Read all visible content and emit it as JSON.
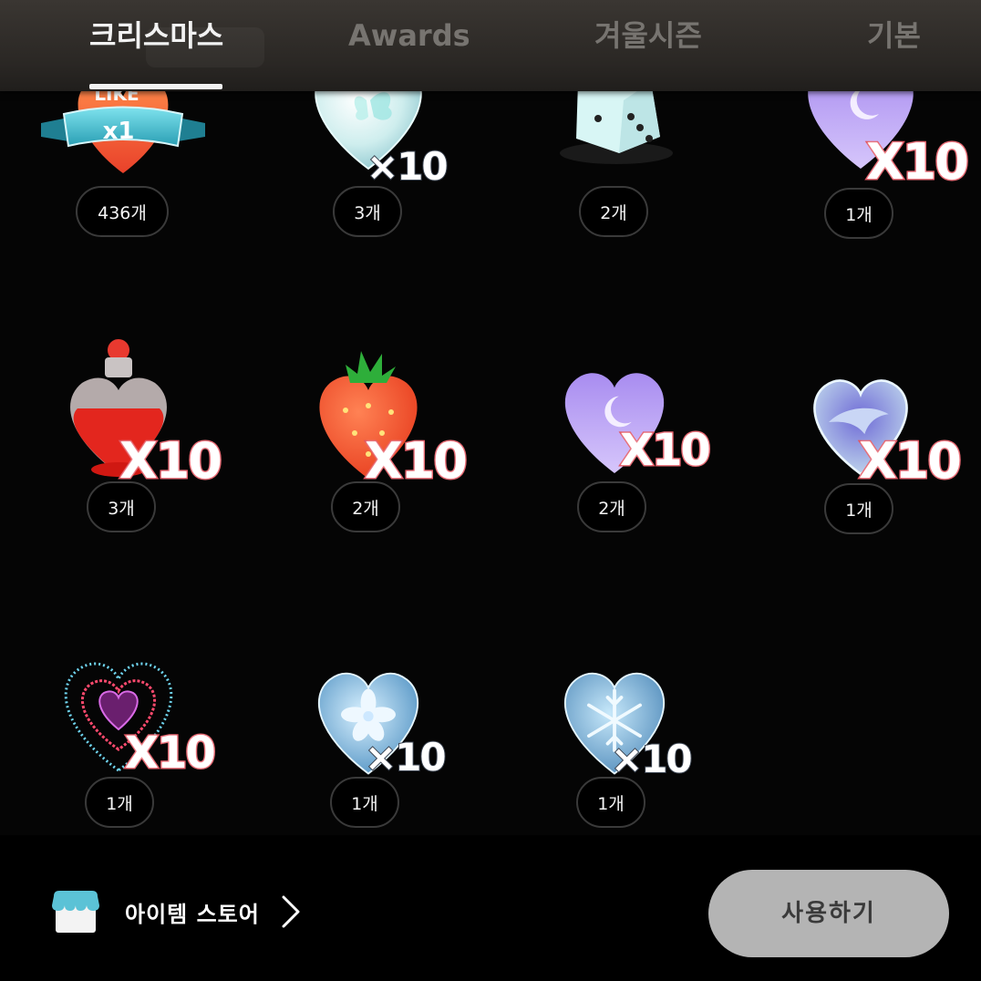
{
  "tabs": [
    {
      "label": "크리스마스",
      "active": true
    },
    {
      "label": "Awards",
      "active": false
    },
    {
      "label": "겨울시즌",
      "active": false
    },
    {
      "label": "기본",
      "active": false
    }
  ],
  "items": [
    {
      "name": "like-ribbon-heart",
      "art_text": "LIKE",
      "art_sub": "x1",
      "multiplier": "",
      "count": "436개"
    },
    {
      "name": "butterfly-crystal-heart",
      "multiplier": "×10",
      "count": "3개"
    },
    {
      "name": "dice",
      "multiplier": "",
      "count": "2개"
    },
    {
      "name": "purple-moon-heart",
      "multiplier": "X10",
      "count": "1개"
    },
    {
      "name": "love-potion-bottle",
      "multiplier": "X10",
      "count": "3개"
    },
    {
      "name": "strawberry-heart",
      "multiplier": "X10",
      "count": "2개"
    },
    {
      "name": "purple-moon-heart",
      "multiplier": "X10",
      "count": "2개"
    },
    {
      "name": "dolphin-bubble-heart",
      "multiplier": "X10",
      "count": "1개"
    },
    {
      "name": "sparkle-neon-heart",
      "multiplier": "X10",
      "count": "1개"
    },
    {
      "name": "ice-flower-heart",
      "multiplier": "×10",
      "count": "1개"
    },
    {
      "name": "snowflake-ice-heart",
      "multiplier": "×10",
      "count": "1개"
    }
  ],
  "bottom": {
    "store_label": "아이템 스토어",
    "use_button": "사용하기"
  },
  "colors": {
    "background": "#050505",
    "tabbar": "#2a2724",
    "use_button_bg": "#b4b4b4",
    "multiplier_stroke": "#e2545f"
  }
}
